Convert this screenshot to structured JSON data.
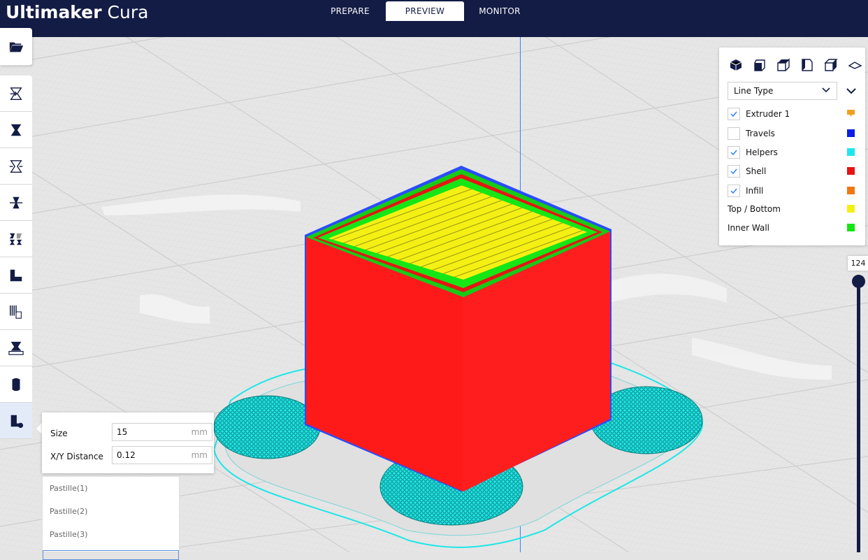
{
  "app": {
    "brand_bold": "Ultimaker",
    "brand_light": "Cura"
  },
  "tabs": [
    {
      "label": "PREPARE",
      "active": false
    },
    {
      "label": "PREVIEW",
      "active": true
    },
    {
      "label": "MONITOR",
      "active": false
    }
  ],
  "toolbar": {
    "tools": [
      "open-file-icon",
      "move-tool-icon",
      "scale-tool-icon",
      "rotate-tool-icon",
      "mirror-tool-icon",
      "per-model-settings-icon",
      "support-blocker-icon",
      "custom-supports-icon",
      "tab-anti-warping-icon",
      "cylinder-icon",
      "pastille-icon"
    ]
  },
  "support_panel": {
    "size_label": "Size",
    "size_value": "15",
    "size_unit": "mm",
    "xy_label": "X/Y Distance",
    "xy_value": "0.12",
    "xy_unit": "mm"
  },
  "pastille_list": [
    "Pastille(1)",
    "Pastille(2)",
    "Pastille(3)"
  ],
  "view_panel": {
    "camera_views": [
      "3d-view-icon",
      "front-view-icon",
      "top-view-icon",
      "left-view-icon",
      "right-view-icon",
      "perspective-toggle-icon"
    ],
    "color_scheme": "Line Type",
    "legend": [
      {
        "label": "Extruder 1",
        "checkbox": true,
        "checked": true,
        "color": "#f0a020",
        "icon": "extruder-icon"
      },
      {
        "label": "Travels",
        "checkbox": true,
        "checked": false,
        "color": "#0a1ee6"
      },
      {
        "label": "Helpers",
        "checkbox": true,
        "checked": true,
        "color": "#1ee6f0"
      },
      {
        "label": "Shell",
        "checkbox": true,
        "checked": true,
        "color": "#e61414"
      },
      {
        "label": "Infill",
        "checkbox": true,
        "checked": true,
        "color": "#f07814"
      },
      {
        "label": "Top / Bottom",
        "checkbox": false,
        "color": "#f5f014"
      },
      {
        "label": "Inner Wall",
        "checkbox": false,
        "color": "#14e614"
      }
    ]
  },
  "layer_slider": {
    "value": "124"
  },
  "colors": {
    "header": "#131c45",
    "accent": "#3282ff"
  }
}
